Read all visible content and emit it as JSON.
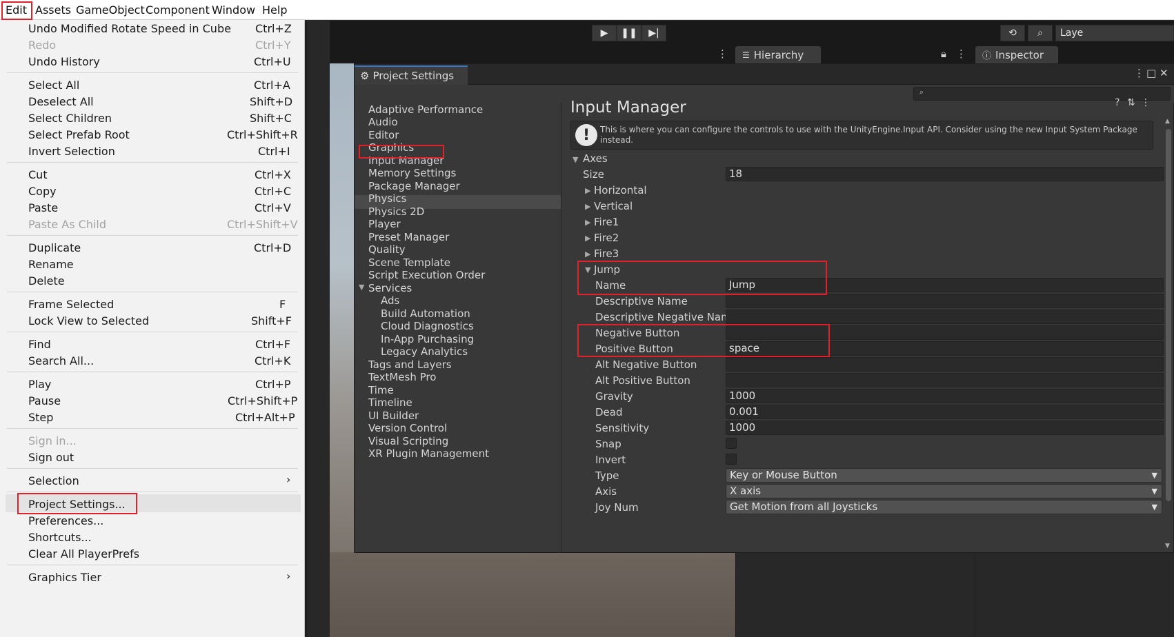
{
  "menubar": {
    "items": [
      "Edit",
      "Assets",
      "GameObject",
      "Component",
      "Window",
      "Help"
    ]
  },
  "toolbar": {
    "layers_label": "Laye"
  },
  "tabs": {
    "hierarchy": "Hierarchy",
    "inspector": "Inspector"
  },
  "edit_menu": {
    "items": [
      {
        "label": "Undo Modified Rotate Speed in Cube",
        "shortcut": "Ctrl+Z"
      },
      {
        "label": "Redo",
        "shortcut": "Ctrl+Y",
        "disabled": true
      },
      {
        "label": "Undo History",
        "shortcut": "Ctrl+U"
      },
      {
        "label": "Select All",
        "shortcut": "Ctrl+A"
      },
      {
        "label": "Deselect All",
        "shortcut": "Shift+D"
      },
      {
        "label": "Select Children",
        "shortcut": "Shift+C"
      },
      {
        "label": "Select Prefab Root",
        "shortcut": "Ctrl+Shift+R"
      },
      {
        "label": "Invert Selection",
        "shortcut": "Ctrl+I"
      },
      {
        "label": "Cut",
        "shortcut": "Ctrl+X"
      },
      {
        "label": "Copy",
        "shortcut": "Ctrl+C"
      },
      {
        "label": "Paste",
        "shortcut": "Ctrl+V"
      },
      {
        "label": "Paste As Child",
        "shortcut": "Ctrl+Shift+V",
        "disabled": true
      },
      {
        "label": "Duplicate",
        "shortcut": "Ctrl+D"
      },
      {
        "label": "Rename",
        "shortcut": ""
      },
      {
        "label": "Delete",
        "shortcut": ""
      },
      {
        "label": "Frame Selected",
        "shortcut": "F"
      },
      {
        "label": "Lock View to Selected",
        "shortcut": "Shift+F"
      },
      {
        "label": "Find",
        "shortcut": "Ctrl+F"
      },
      {
        "label": "Search All...",
        "shortcut": "Ctrl+K"
      },
      {
        "label": "Play",
        "shortcut": "Ctrl+P"
      },
      {
        "label": "Pause",
        "shortcut": "Ctrl+Shift+P"
      },
      {
        "label": "Step",
        "shortcut": "Ctrl+Alt+P"
      },
      {
        "label": "Sign in...",
        "shortcut": "",
        "disabled": true
      },
      {
        "label": "Sign out",
        "shortcut": ""
      },
      {
        "label": "Selection",
        "shortcut": ""
      },
      {
        "label": "Project Settings...",
        "shortcut": ""
      },
      {
        "label": "Preferences...",
        "shortcut": ""
      },
      {
        "label": "Shortcuts...",
        "shortcut": ""
      },
      {
        "label": "Clear All PlayerPrefs",
        "shortcut": ""
      },
      {
        "label": "Graphics Tier",
        "shortcut": ""
      }
    ]
  },
  "project_settings": {
    "title": "Project Settings",
    "categories": [
      "Adaptive Performance",
      "Audio",
      "Editor",
      "Graphics",
      "Input Manager",
      "Memory Settings",
      "Package Manager",
      "Physics",
      "Physics 2D",
      "Player",
      "Preset Manager",
      "Quality",
      "Scene Template",
      "Script Execution Order",
      "Services",
      "Ads",
      "Build Automation",
      "Cloud Diagnostics",
      "In-App Purchasing",
      "Legacy Analytics",
      "Tags and Layers",
      "TextMesh Pro",
      "Time",
      "Timeline",
      "UI Builder",
      "Version Control",
      "Visual Scripting",
      "XR Plugin Management"
    ],
    "selected": "Input Manager"
  },
  "input_manager": {
    "title": "Input Manager",
    "info": "This is where you can configure the controls to use with the UnityEngine.Input API. Consider using the new Input System Package instead.",
    "axes_label": "Axes",
    "size_label": "Size",
    "size_value": "18",
    "axes": [
      "Horizontal",
      "Vertical",
      "Fire1",
      "Fire2",
      "Fire3",
      "Jump"
    ],
    "props": {
      "name": {
        "label": "Name",
        "value": "Jump"
      },
      "descriptive_name": {
        "label": "Descriptive Name",
        "value": ""
      },
      "descriptive_negative_name": {
        "label": "Descriptive Negative Name",
        "value": ""
      },
      "negative_button": {
        "label": "Negative Button",
        "value": ""
      },
      "positive_button": {
        "label": "Positive Button",
        "value": "space"
      },
      "alt_negative_button": {
        "label": "Alt Negative Button",
        "value": ""
      },
      "alt_positive_button": {
        "label": "Alt Positive Button",
        "value": ""
      },
      "gravity": {
        "label": "Gravity",
        "value": "1000"
      },
      "dead": {
        "label": "Dead",
        "value": "0.001"
      },
      "sensitivity": {
        "label": "Sensitivity",
        "value": "1000"
      },
      "snap": {
        "label": "Snap",
        "checked": false
      },
      "invert": {
        "label": "Invert",
        "checked": false
      },
      "type": {
        "label": "Type",
        "value": "Key or Mouse Button"
      },
      "axis": {
        "label": "Axis",
        "value": "X axis"
      },
      "joy_num": {
        "label": "Joy Num",
        "value": "Get Motion from all Joysticks"
      }
    }
  },
  "colors": {
    "highlight_box": "#e0202a",
    "accent_tab": "#3a78c4"
  }
}
